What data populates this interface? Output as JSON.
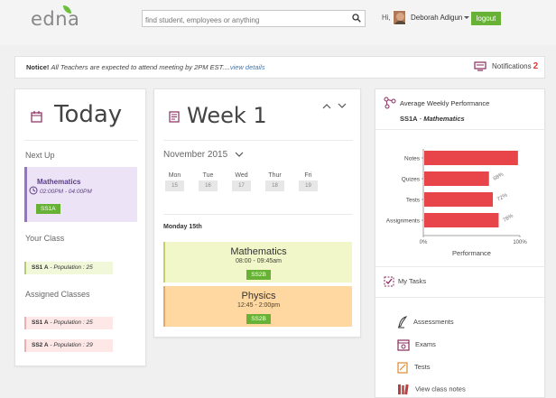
{
  "header": {
    "logo": "edna",
    "search_placeholder": "find student, employees or anything",
    "greeting": "Hi,",
    "user_name": "Deborah Adigun",
    "logout_label": "logout"
  },
  "notice": {
    "label": "Notice!",
    "message": "All Teachers are expected to attend meeting by 2PM EST....",
    "link": "view details",
    "notifications_label": "Notifications",
    "notifications_count": "2"
  },
  "today": {
    "title": "Today",
    "next_up_label": "Next Up",
    "next_up": {
      "subject": "Mathematics",
      "time": "02:00PM - 04:00PM",
      "class": "SS1A"
    },
    "your_class_label": "Your Class",
    "your_class": {
      "name": "SS1 A",
      "population": "- Population : 25"
    },
    "assigned_label": "Assigned Classes",
    "assigned": [
      {
        "name": "SS1 A",
        "population": "- Population : 25"
      },
      {
        "name": "SS2 A",
        "population": "- Population : 29"
      }
    ]
  },
  "week": {
    "title": "Week 1",
    "month": "November 2015",
    "days": [
      {
        "name": "Mon",
        "date": "15"
      },
      {
        "name": "Tue",
        "date": "16"
      },
      {
        "name": "Wed",
        "date": "17"
      },
      {
        "name": "Thur",
        "date": "18"
      },
      {
        "name": "Fri",
        "date": "19"
      }
    ],
    "selected_date": "Monday 15th",
    "events": [
      {
        "subject": "Mathematics",
        "time": "08:00 - 09:45am",
        "class": "SS2B"
      },
      {
        "subject": "Physics",
        "time": "12:45 - 2:00pm",
        "class": "SS2B"
      }
    ]
  },
  "performance": {
    "title": "Average Weekly Performance",
    "class": "SS1A",
    "subject": "Mathematics",
    "my_tasks_label": "My Tasks",
    "menu": [
      "Assessments",
      "Exams",
      "Tests",
      "View class notes"
    ]
  },
  "chart_data": {
    "type": "bar",
    "orientation": "horizontal",
    "categories": [
      "Notes",
      "Quizes",
      "Tests",
      "Assignments"
    ],
    "values": [
      98,
      68,
      72,
      78
    ],
    "data_labels": [
      "",
      "68%",
      "72%",
      "78%"
    ],
    "xlabel": "Performance",
    "xlim": [
      0,
      100
    ],
    "xticks": [
      "0%",
      "100%"
    ],
    "color": "#e8454b"
  }
}
